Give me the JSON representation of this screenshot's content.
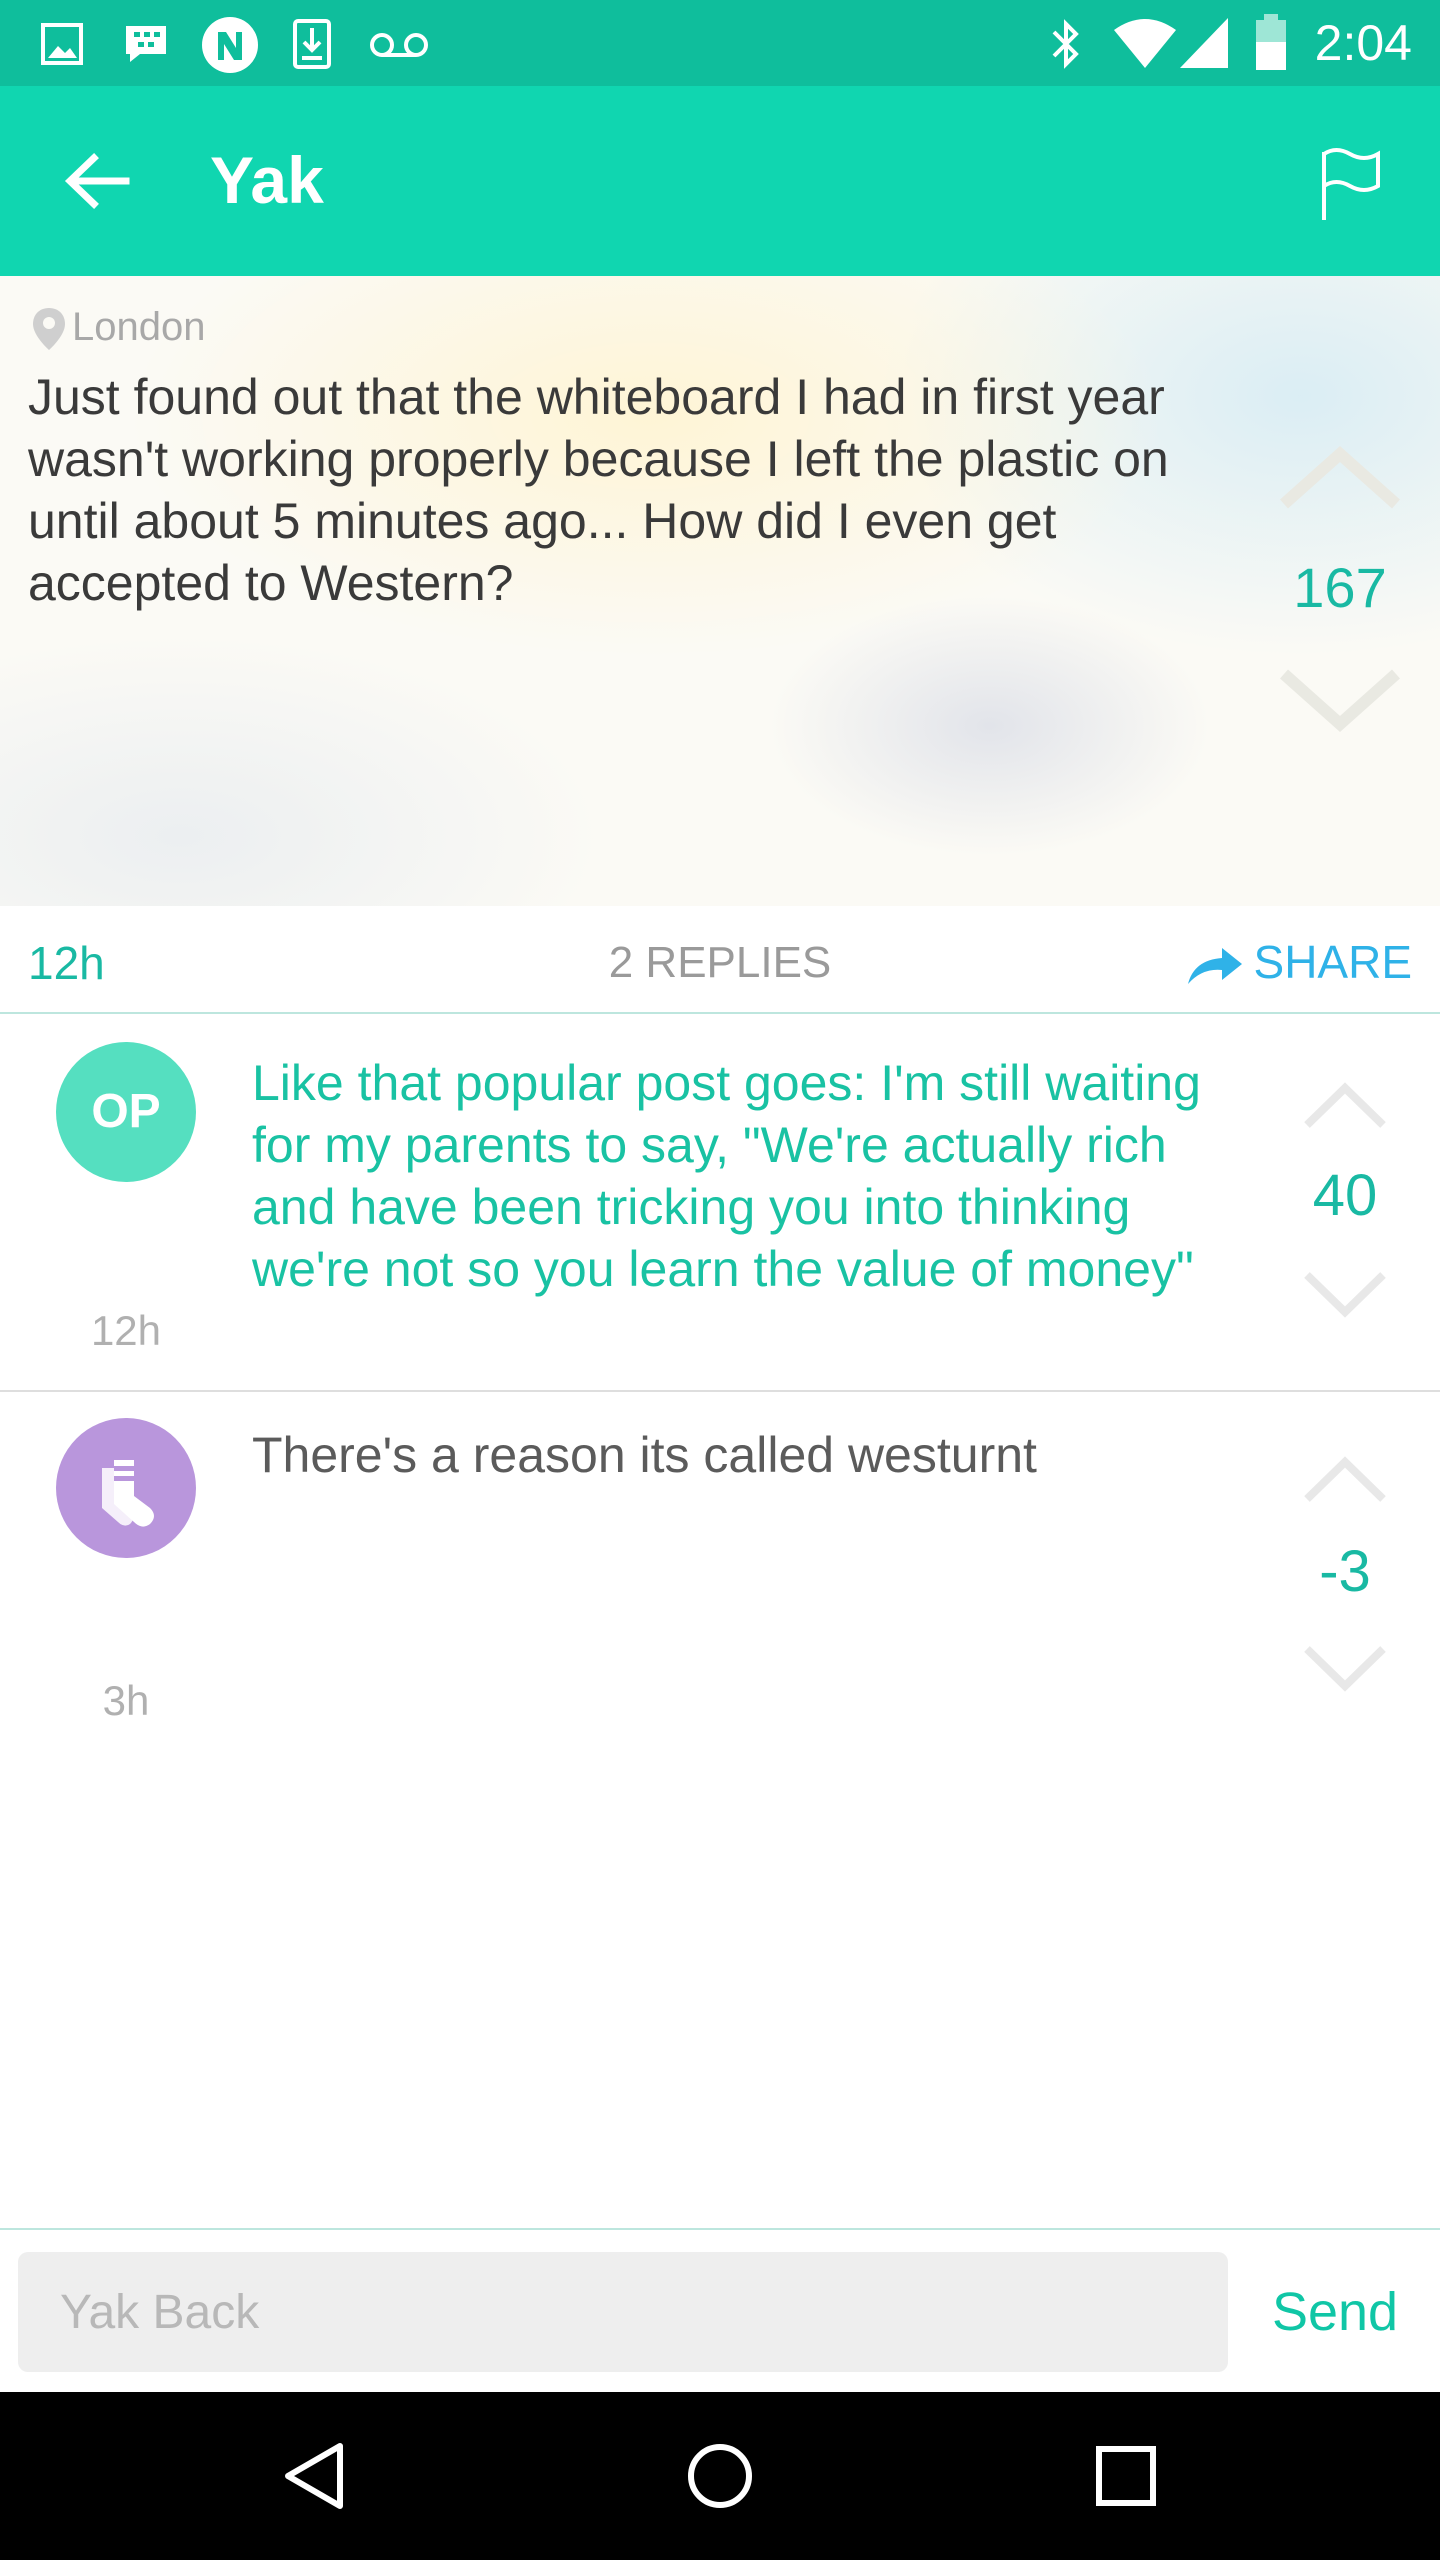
{
  "status_bar": {
    "time": "2:04",
    "left_icons": [
      "image-icon",
      "bbm-chat-icon",
      "n-app-icon",
      "download-icon",
      "voicemail-icon"
    ],
    "right_icons": [
      "bluetooth-icon",
      "wifi-icon",
      "cell-signal-icon",
      "battery-icon"
    ]
  },
  "app_bar": {
    "title": "Yak",
    "back_icon": "arrow-back-icon",
    "flag_icon": "flag-icon"
  },
  "post": {
    "location": "London",
    "text": "Just found out that the whiteboard I had in first year wasn't working properly because I left the plastic on until about 5 minutes ago... How did I even get accepted to Western?",
    "score": "167",
    "age": "12h",
    "replies_label": "2 REPLIES",
    "share_label": "SHARE"
  },
  "replies": [
    {
      "avatar_label": "OP",
      "avatar_color": "#55dfc0",
      "text": "Like that popular post goes: I'm still waiting for my parents to say, \"We're actually rich and have been tricking you into thinking we're not so you learn the value of money\"",
      "text_color": "#19c2a3",
      "age": "12h",
      "score": "40"
    },
    {
      "avatar_icon": "socks-icon",
      "avatar_color": "#b996dc",
      "text": "There's a reason its called westurnt",
      "text_color": "#5b5b5b",
      "age": "3h",
      "score": "-3"
    }
  ],
  "composer": {
    "placeholder": "Yak Back",
    "send_label": "Send"
  },
  "colors": {
    "status_bar": "#0fbe9c",
    "app_bar": "#10d6b0",
    "accent": "#19b9a3",
    "share_blue": "#2fb2e8"
  }
}
